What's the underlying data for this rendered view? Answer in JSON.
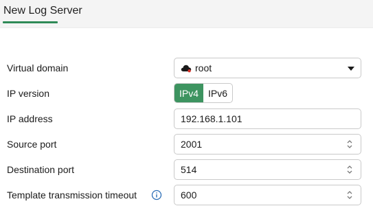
{
  "header": {
    "title": "New Log Server"
  },
  "form": {
    "virtual_domain": {
      "label": "Virtual domain",
      "value": "root"
    },
    "ip_version": {
      "label": "IP version",
      "options": [
        "IPv4",
        "IPv6"
      ],
      "selected": "IPv4"
    },
    "ip_address": {
      "label": "IP address",
      "value": "192.168.1.101"
    },
    "source_port": {
      "label": "Source port",
      "value": "2001"
    },
    "destination_port": {
      "label": "Destination port",
      "value": "514"
    },
    "template_timeout": {
      "label": "Template transmission timeout",
      "value": "600"
    }
  },
  "colors": {
    "accent": "#3d9460",
    "tab_underline": "#2f8a57",
    "header_bg": "#f4f4f4"
  },
  "icons": {
    "domain": "cloud-icon",
    "info": "info-icon",
    "dropdown": "caret-down-icon",
    "stepper": "stepper-icon"
  }
}
